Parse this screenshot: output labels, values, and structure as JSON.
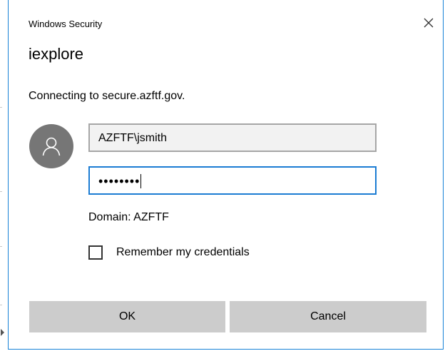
{
  "window": {
    "title": "Windows Security",
    "close_icon": "close-icon"
  },
  "dialog": {
    "app_name": "iexplore",
    "message": "Connecting to secure.azftf.gov.",
    "avatar_icon": "user-avatar-icon"
  },
  "credentials": {
    "username": "AZFTF\\jsmith",
    "password_masked": "••••••••",
    "domain": "Domain: AZFTF",
    "remember_label": "Remember my credentials",
    "remember_checked": false
  },
  "buttons": {
    "ok": "OK",
    "cancel": "Cancel"
  },
  "colors": {
    "accent": "#1b7cd3",
    "button_bg": "#cccccc",
    "avatar_bg": "#767676"
  }
}
